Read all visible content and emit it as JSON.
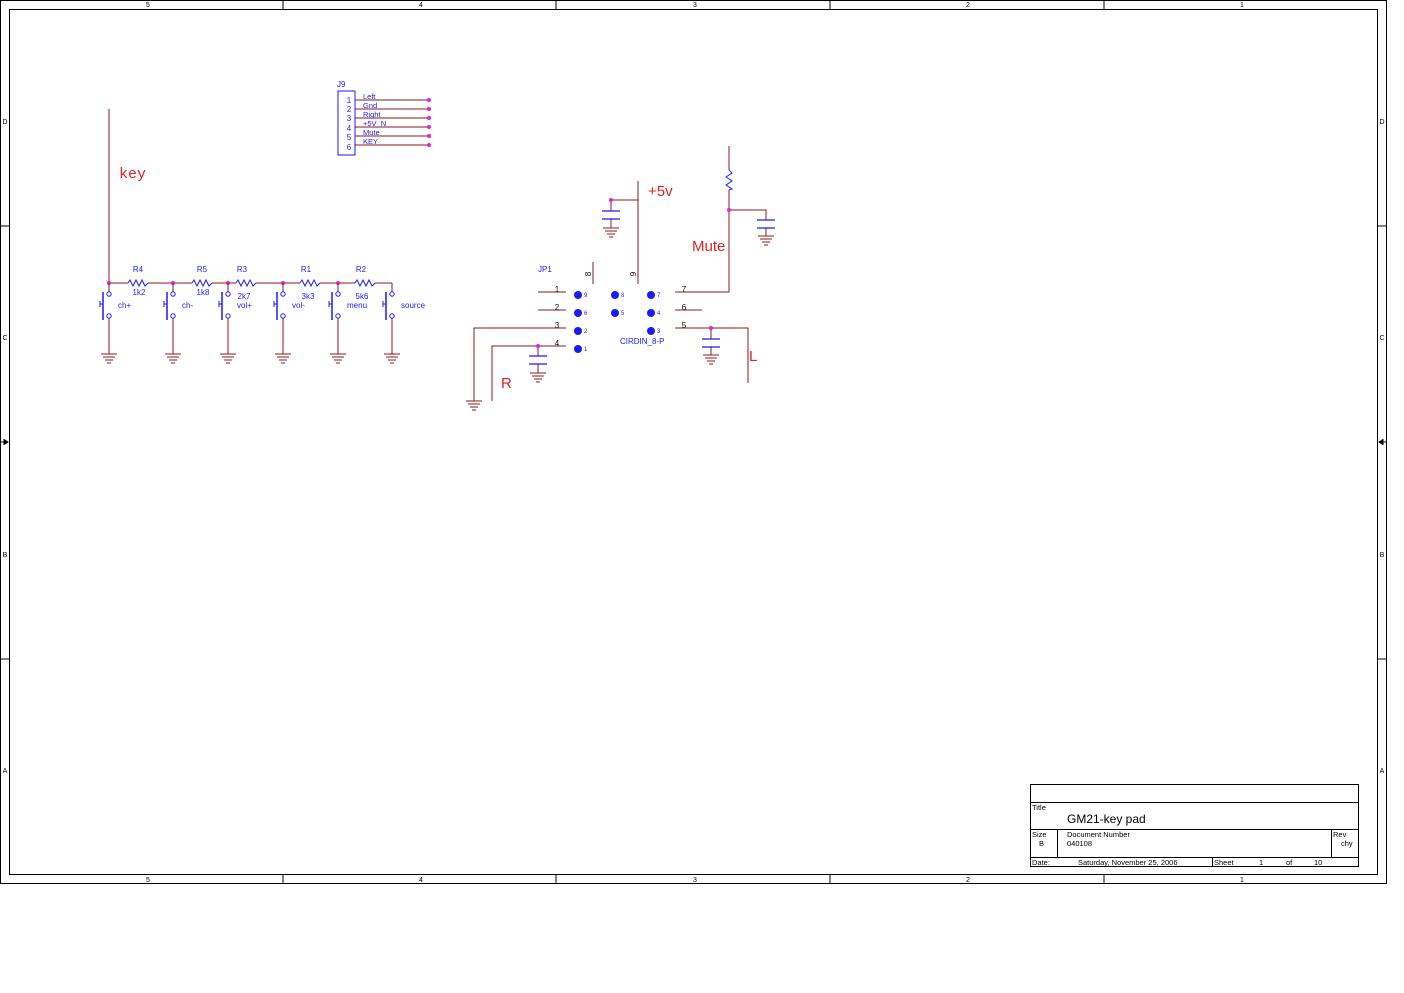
{
  "colors": {
    "frame": "#000000",
    "wire": "#8b1a1a",
    "part": "#1a1aff",
    "junction": "#e020e0",
    "netlabel": "#dd2222",
    "ground": "#8b1a1a"
  },
  "frame": {
    "columns": [
      "5",
      "4",
      "3",
      "2",
      "1"
    ],
    "rows": [
      "D",
      "C",
      "B",
      "A"
    ]
  },
  "nets": {
    "key": "key",
    "plus5v": "+5v",
    "mute": "Mute",
    "left": "L",
    "right": "R"
  },
  "connector_j9": {
    "ref": "J9",
    "pins": [
      {
        "num": "1",
        "signal": "Left"
      },
      {
        "num": "2",
        "signal": "Gnd"
      },
      {
        "num": "3",
        "signal": "Right"
      },
      {
        "num": "4",
        "signal": "+5V_N"
      },
      {
        "num": "5",
        "signal": "Mute"
      },
      {
        "num": "6",
        "signal": "KEY"
      }
    ]
  },
  "resistors": [
    {
      "ref": "R4",
      "value": "1k2"
    },
    {
      "ref": "R5",
      "value": "1k8"
    },
    {
      "ref": "R3",
      "value": "2k7"
    },
    {
      "ref": "R1",
      "value": "3k3"
    },
    {
      "ref": "R2",
      "value": "5k6"
    }
  ],
  "switches": [
    "ch+",
    "ch-",
    "vol+",
    "vol-",
    "menu",
    "source"
  ],
  "connector_jp1": {
    "ref": "JP1",
    "part": "CIRDIN_8-P",
    "left_pins": [
      "1",
      "2",
      "3",
      "4"
    ],
    "right_pins": [
      "7",
      "6",
      "5"
    ],
    "top_pins": [
      "8",
      "9"
    ],
    "pad_labels": [
      "9",
      "8",
      "7",
      "6",
      "5",
      "4",
      "2",
      "3",
      "1"
    ]
  },
  "title_block": {
    "title_label": "Title",
    "title": "GM21-key pad",
    "size_label": "Size",
    "size": "B",
    "docnum_label": "Document Number",
    "docnum": "040108",
    "rev_label": "Rev",
    "rev": "chy",
    "date_label": "Date:",
    "date": "Saturday, November 25, 2006",
    "sheet_label": "Sheet",
    "sheet": "1",
    "of_label": "of",
    "total": "10"
  }
}
